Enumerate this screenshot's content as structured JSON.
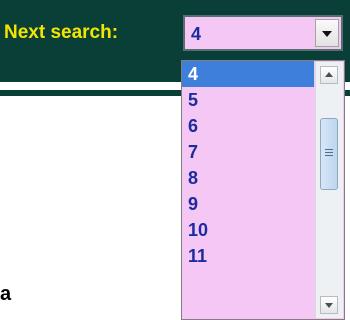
{
  "header": {
    "label": "Next search:"
  },
  "select": {
    "current_value": "4",
    "options": [
      "4",
      "5",
      "6",
      "7",
      "8",
      "9",
      "10",
      "11"
    ],
    "highlighted_option": "4"
  },
  "page": {
    "edge_text": "a"
  },
  "colors": {
    "header_bg": "#0a3f37",
    "label_text": "#f2e600",
    "select_bg": "#f5c7f5",
    "option_text": "#1d2ba0",
    "highlight_bg": "#3f7fdc"
  },
  "icons": {
    "select_arrow": "chevron-down-icon",
    "scroll_up": "scroll-up-icon",
    "scroll_down": "scroll-down-icon"
  }
}
